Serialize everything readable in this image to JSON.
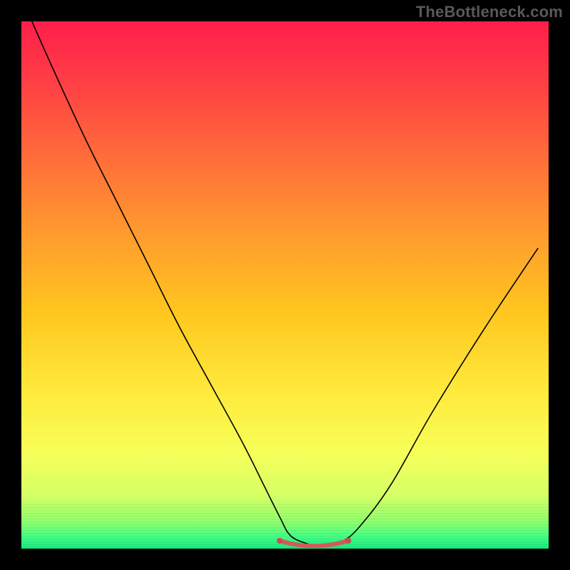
{
  "watermark": "TheBottleneck.com",
  "colors": {
    "frame": "#000000",
    "curve": "#000000",
    "highlight": "#d15a5a",
    "highlight_dot": "#c94f4f",
    "gradient_stops": [
      {
        "offset": 0.0,
        "color": "#ff1f4b"
      },
      {
        "offset": 0.1,
        "color": "#ff3a46"
      },
      {
        "offset": 0.25,
        "color": "#ff6a3a"
      },
      {
        "offset": 0.4,
        "color": "#ff9a2e"
      },
      {
        "offset": 0.55,
        "color": "#ffc61f"
      },
      {
        "offset": 0.7,
        "color": "#ffe93a"
      },
      {
        "offset": 0.82,
        "color": "#f7ff5a"
      },
      {
        "offset": 0.9,
        "color": "#d4ff66"
      },
      {
        "offset": 0.95,
        "color": "#8fff6e"
      },
      {
        "offset": 0.975,
        "color": "#49ff84"
      },
      {
        "offset": 1.0,
        "color": "#17e881"
      }
    ]
  },
  "chart_data": {
    "type": "line",
    "title": "",
    "xlabel": "",
    "ylabel": "",
    "xlim": [
      0,
      100
    ],
    "ylim": [
      0,
      100
    ],
    "grid": false,
    "series": [
      {
        "name": "bottleneck-curve",
        "x": [
          2,
          6,
          12,
          18,
          24,
          30,
          36,
          42,
          46,
          49,
          51,
          54,
          56,
          58,
          59.5,
          61,
          64,
          70,
          78,
          88,
          98
        ],
        "y": [
          100,
          91,
          78,
          66,
          54,
          42,
          31,
          20,
          12,
          6,
          2.5,
          1.0,
          0.6,
          0.6,
          0.8,
          1.4,
          4,
          12,
          26,
          42,
          57
        ]
      }
    ],
    "highlight_range_x": [
      49,
      62
    ],
    "highlight_y_approx": 1.2,
    "annotations": []
  }
}
